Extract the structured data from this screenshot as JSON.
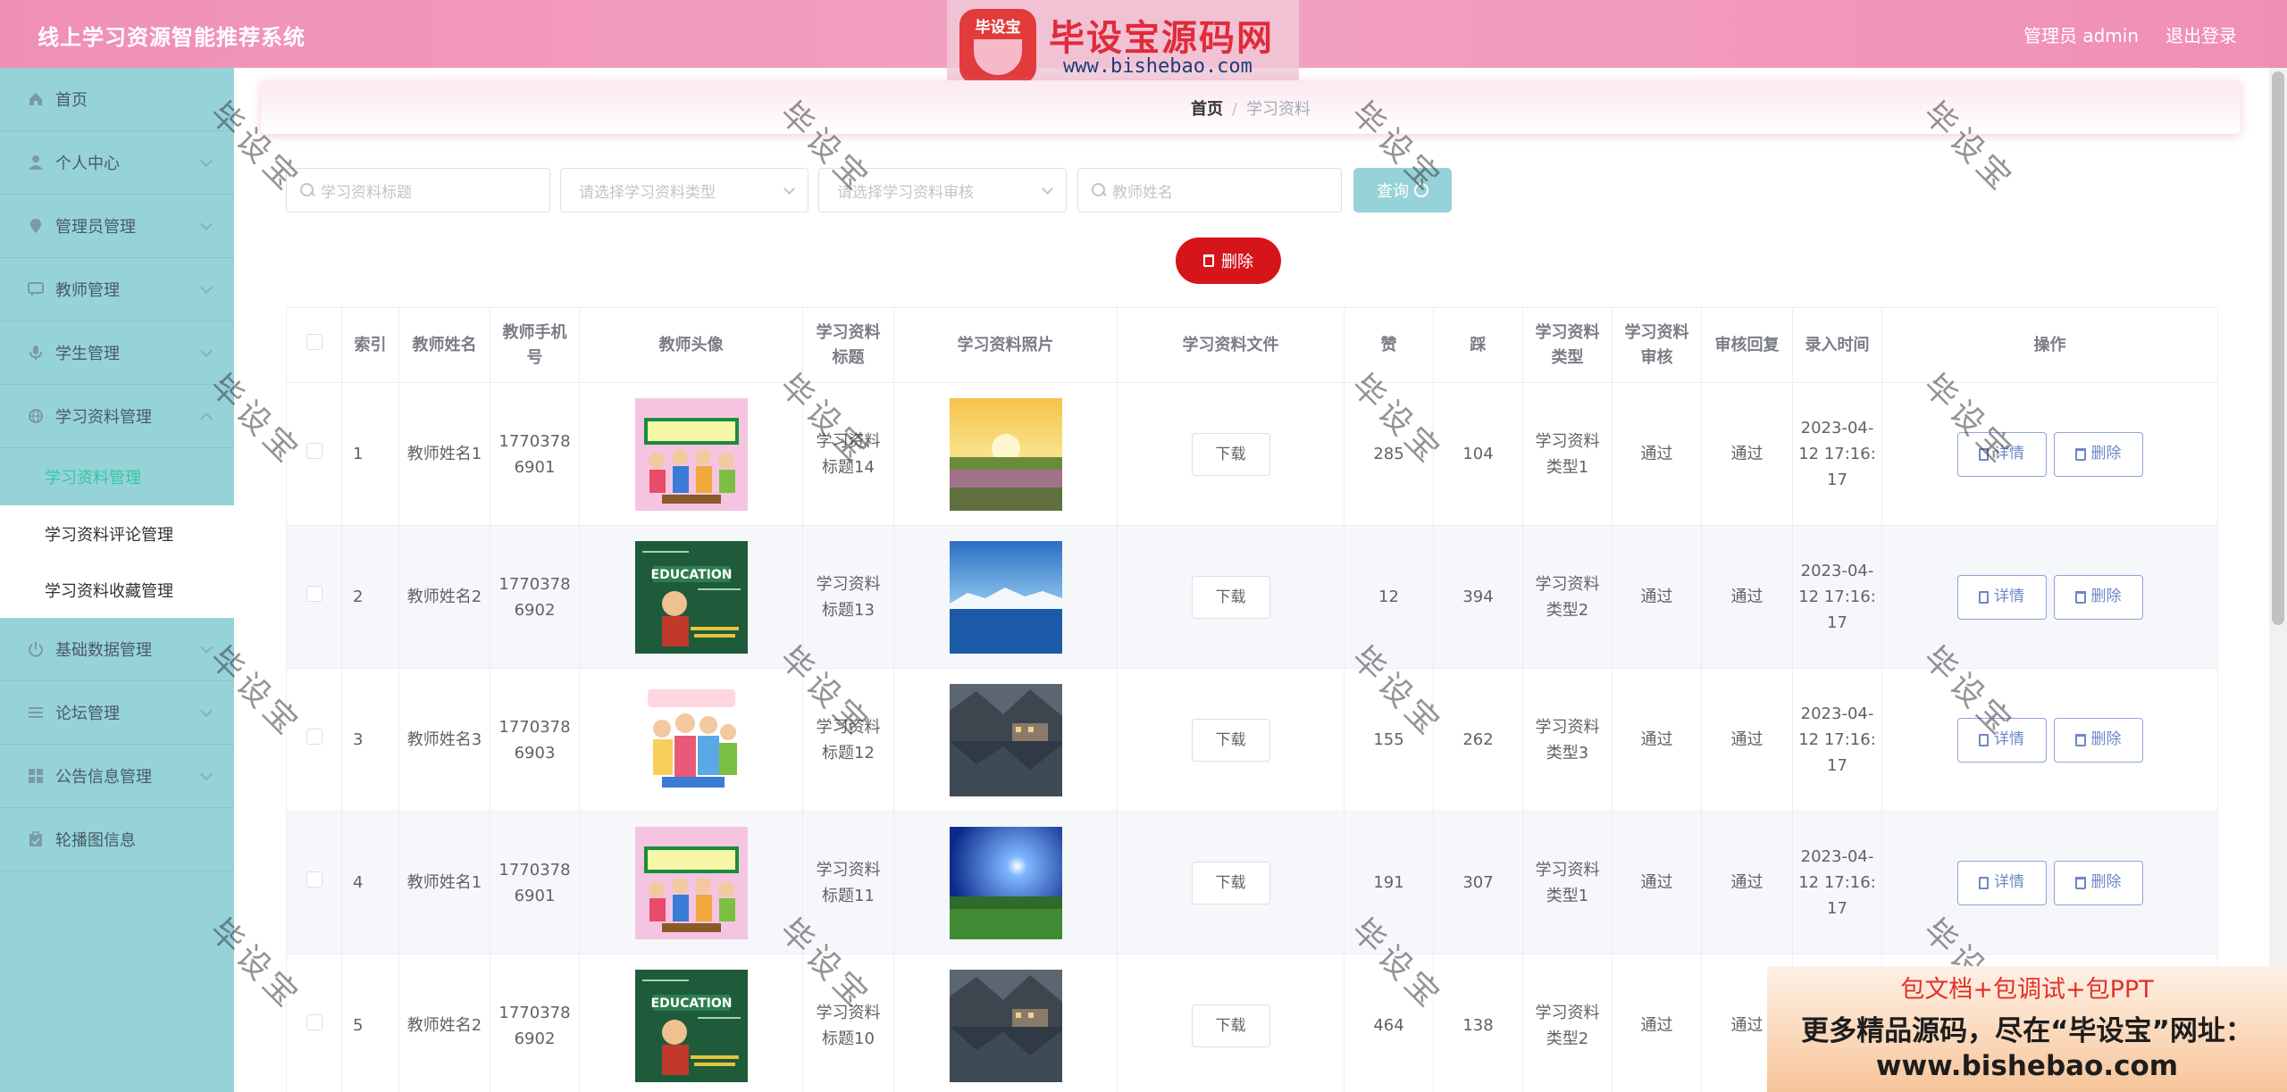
{
  "header": {
    "app_title": "线上学习资源智能推荐系统",
    "user_label": "管理员 admin",
    "logout_label": "退出登录"
  },
  "brand": {
    "seal_text": "毕设宝",
    "name": "毕设宝源码网",
    "url": "www.bishebao.com"
  },
  "sidebar": {
    "items": [
      {
        "label": "首页",
        "icon": "home-icon"
      },
      {
        "label": "个人中心",
        "icon": "user-icon"
      },
      {
        "label": "管理员管理",
        "icon": "location-icon"
      },
      {
        "label": "教师管理",
        "icon": "chat-icon"
      },
      {
        "label": "学生管理",
        "icon": "microphone-icon"
      },
      {
        "label": "学习资料管理",
        "icon": "globe-icon"
      },
      {
        "label": "基础数据管理",
        "icon": "power-icon"
      },
      {
        "label": "论坛管理",
        "icon": "list-icon"
      },
      {
        "label": "公告信息管理",
        "icon": "grid-icon"
      },
      {
        "label": "轮播图信息",
        "icon": "clipboard-icon"
      }
    ],
    "subitems": [
      "学习资料管理",
      "学习资料评论管理",
      "学习资料收藏管理"
    ]
  },
  "breadcrumb": {
    "home": "首页",
    "separator": "/",
    "current": "学习资料"
  },
  "filters": {
    "title_placeholder": "学习资料标题",
    "type_placeholder": "请选择学习资料类型",
    "audit_placeholder": "请选择学习资料审核",
    "teacher_placeholder": "教师姓名",
    "query_label": "查询"
  },
  "actions": {
    "delete_label": "删除"
  },
  "table": {
    "columns": [
      "索引",
      "教师姓名",
      "教师手机号",
      "教师头像",
      "学习资料标题",
      "学习资料照片",
      "学习资料文件",
      "赞",
      "踩",
      "学习资料类型",
      "学习资料审核",
      "审核回复",
      "录入时间",
      "操作"
    ],
    "download_label": "下载",
    "detail_label": "详情",
    "delete_label": "删除",
    "rows": [
      {
        "index": "1",
        "teacher": "教师姓名1",
        "phone": "17703786901",
        "avatar": "avatar-banner",
        "title": "学习资料标题14",
        "photo": "sunset",
        "likes": "285",
        "dislikes": "104",
        "type": "学习资料类型1",
        "audit": "通过",
        "reply": "通过",
        "time": "2023-04-12 17:16:17"
      },
      {
        "index": "2",
        "teacher": "教师姓名2",
        "phone": "17703786902",
        "avatar": "avatar-education",
        "title": "学习资料标题13",
        "photo": "glacier",
        "likes": "12",
        "dislikes": "394",
        "type": "学习资料类型2",
        "audit": "通过",
        "reply": "通过",
        "time": "2023-04-12 17:16:17"
      },
      {
        "index": "3",
        "teacher": "教师姓名3",
        "phone": "17703786903",
        "avatar": "avatar-teachers-day",
        "title": "学习资料标题12",
        "photo": "lake-village",
        "likes": "155",
        "dislikes": "262",
        "type": "学习资料类型3",
        "audit": "通过",
        "reply": "通过",
        "time": "2023-04-12 17:16:17"
      },
      {
        "index": "4",
        "teacher": "教师姓名1",
        "phone": "17703786901",
        "avatar": "avatar-banner",
        "title": "学习资料标题11",
        "photo": "night-field",
        "likes": "191",
        "dislikes": "307",
        "type": "学习资料类型1",
        "audit": "通过",
        "reply": "通过",
        "time": "2023-04-12 17:16:17"
      },
      {
        "index": "5",
        "teacher": "教师姓名2",
        "phone": "17703786902",
        "avatar": "avatar-education",
        "title": "学习资料标题10",
        "photo": "lake-village",
        "likes": "464",
        "dislikes": "138",
        "type": "学习资料类型2",
        "audit": "通过",
        "reply": "通过",
        "time": ""
      }
    ]
  },
  "watermark": {
    "text": "毕设宝"
  },
  "ad_banner": {
    "line1": "包文档+包调试+包PPT",
    "line2": "更多精品源码，尽在“毕设宝”网址：",
    "line3": "www.bishebao.com"
  },
  "colors": {
    "topbar": "#f08fb6",
    "sidebar": "#96d3d8",
    "active_text": "#36c7a1",
    "danger": "#d6151b"
  }
}
